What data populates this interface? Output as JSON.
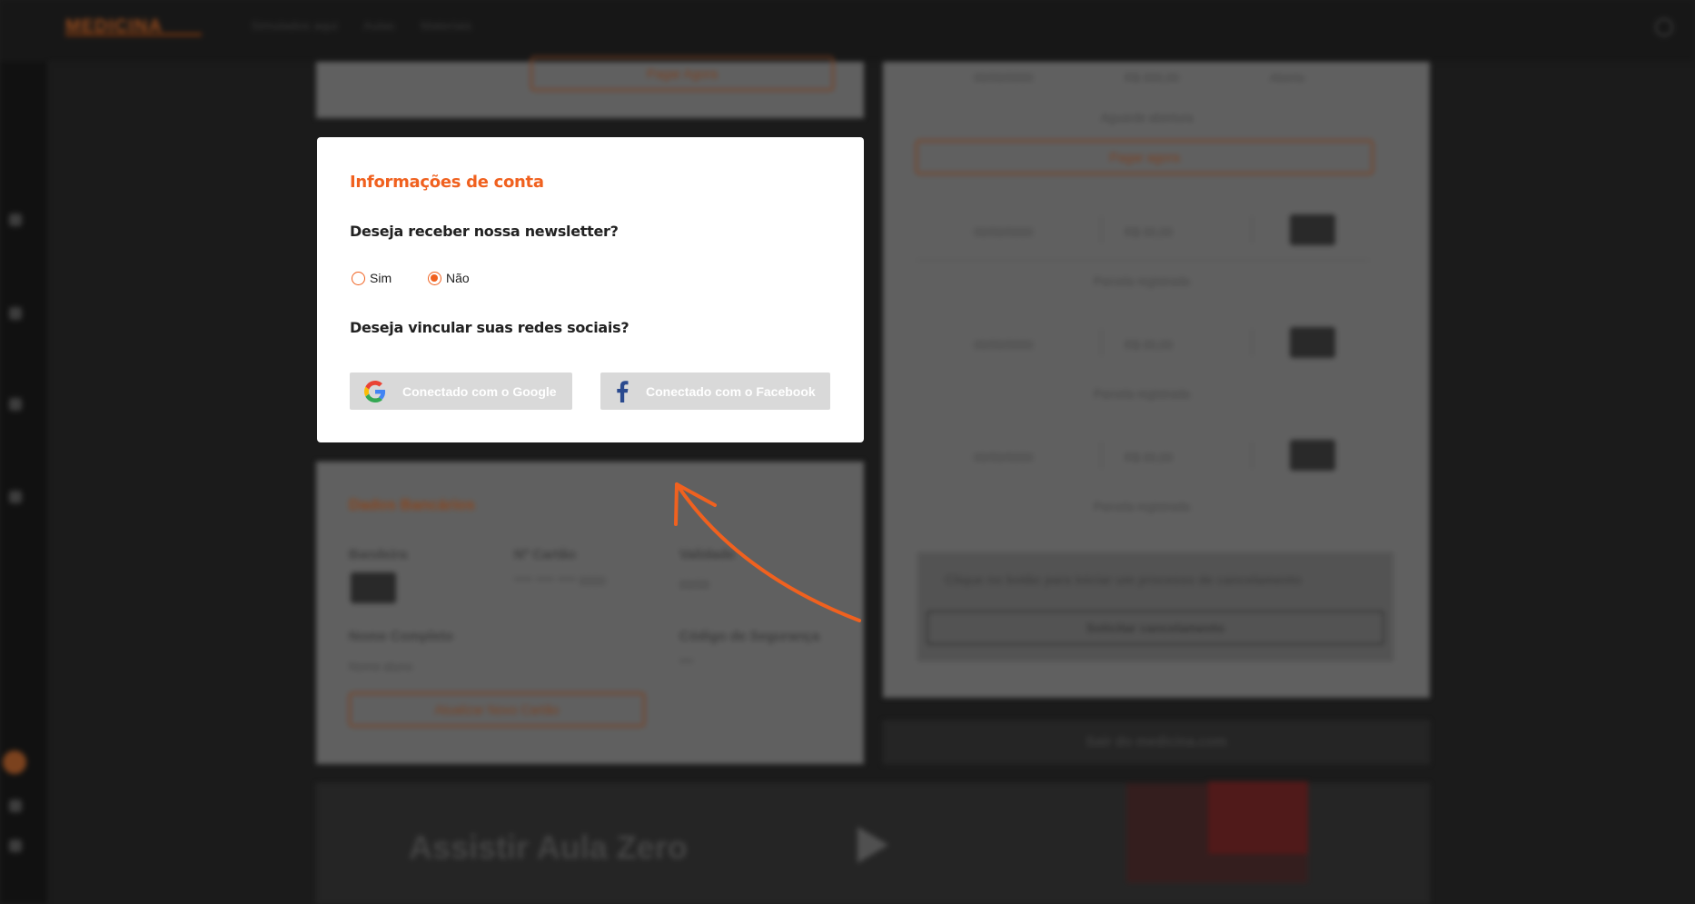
{
  "header": {
    "logo_text": "MEDICINA",
    "nav": [
      "Simulados aqui",
      "Aulas",
      "Materiais"
    ]
  },
  "background": {
    "top_left_card_button": "Pagar Agora",
    "right_panel": {
      "row0": {
        "date": "00/00/0000",
        "value": "R$ 000,00",
        "status": "Aberto"
      },
      "row0_label": "Aguarde abertura",
      "pay_button": "Pagar agora",
      "rows": [
        {
          "date": "00/00/0000",
          "value": "R$ 00,00",
          "label": "Parcela registrada"
        },
        {
          "date": "00/00/0000",
          "value": "R$ 00,00",
          "label": "Parcela registrada"
        },
        {
          "date": "00/00/0000",
          "value": "R$ 00,00",
          "label": "Parcela registrada"
        }
      ],
      "cancel_prompt": "Clique no botão para iniciar um processo de cancelamento",
      "cancel_button": "Solicitar cancelamento",
      "exit_button": "Sair do medicina.com"
    },
    "card_info": {
      "title": "Dados Bancários",
      "flag_label": "Bandeira",
      "number_label": "Nº Cartão",
      "number_value": "**** **** **** 0000",
      "validity_label": "Validade",
      "validity_value": "00/00",
      "name_label": "Nome Completo",
      "name_value": "Nome aluno",
      "cvv_label": "Código de Segurança",
      "cvv_value": "***",
      "update_button": "Atualizar Novo Cartão"
    },
    "banner_title": "Assistir Aula Zero"
  },
  "modal": {
    "title": "Informações de conta",
    "newsletter_question": "Deseja receber nossa newsletter?",
    "options": [
      "Sim",
      "Não"
    ],
    "selected_option": "Não",
    "social_question": "Deseja vincular suas redes sociais?",
    "google_button": "Conectado com o Google",
    "facebook_button": "Conectado com o Facebook"
  },
  "colors": {
    "accent": "#f0611f",
    "modal_bg": "#ffffff",
    "social_button_bg": "#d9d9d9",
    "arrow": "#f0611f"
  },
  "icons": [
    "google-icon",
    "facebook-icon",
    "arrow-curve-icon",
    "search-icon",
    "play-icon"
  ]
}
